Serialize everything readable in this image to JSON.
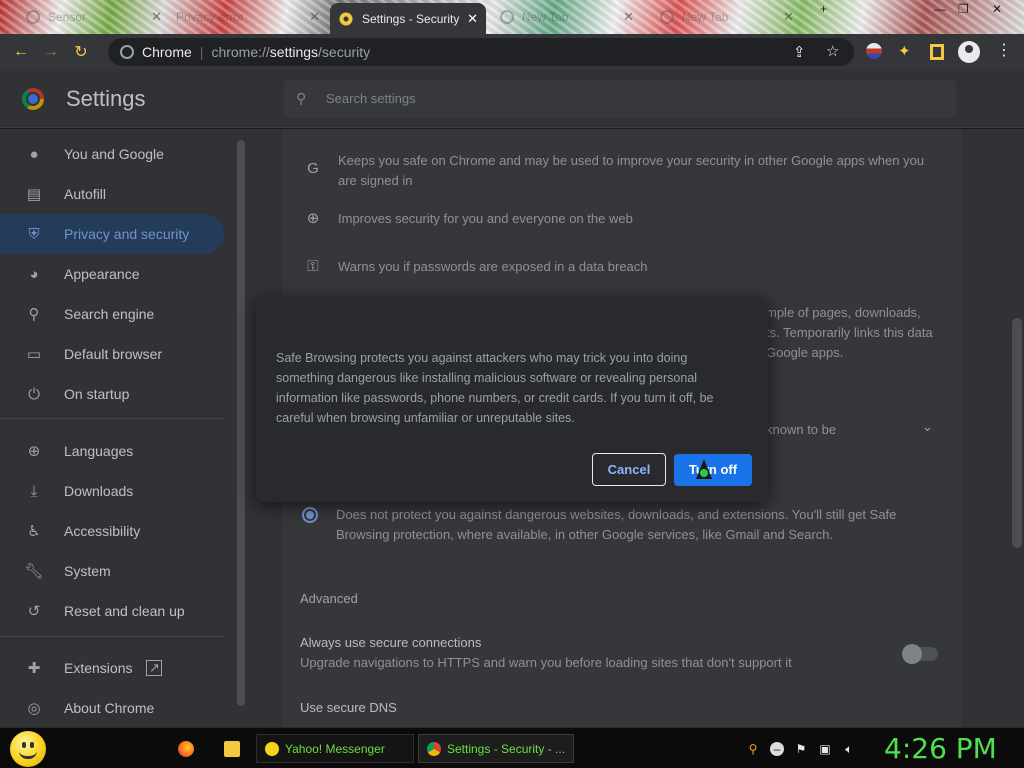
{
  "browser": {
    "tabs": [
      {
        "label": "Sensor",
        "active": false
      },
      {
        "label": "Privacy error",
        "active": false
      },
      {
        "label": "Settings - Security",
        "active": true
      },
      {
        "label": "New Tab",
        "active": false
      },
      {
        "label": "New Tab",
        "active": false
      }
    ],
    "omnibox": {
      "site": "Chrome",
      "url_prefix": "chrome://",
      "url_main": "settings",
      "url_suffix": "/security"
    }
  },
  "settings": {
    "title": "Settings",
    "search_placeholder": "Search settings",
    "sidebar": [
      {
        "label": "You and Google",
        "icon": "person-icon"
      },
      {
        "label": "Autofill",
        "icon": "clipboard-icon"
      },
      {
        "label": "Privacy and security",
        "icon": "shield-icon",
        "selected": true
      },
      {
        "label": "Appearance",
        "icon": "palette-icon"
      },
      {
        "label": "Search engine",
        "icon": "search-icon"
      },
      {
        "label": "Default browser",
        "icon": "browser-icon"
      },
      {
        "label": "On startup",
        "icon": "power-icon"
      },
      {
        "label": "Languages",
        "icon": "globe-icon"
      },
      {
        "label": "Downloads",
        "icon": "download-icon"
      },
      {
        "label": "Accessibility",
        "icon": "accessibility-icon"
      },
      {
        "label": "System",
        "icon": "wrench-icon"
      },
      {
        "label": "Reset and clean up",
        "icon": "restore-icon"
      },
      {
        "label": "Extensions",
        "icon": "puzzle-icon"
      },
      {
        "label": "About Chrome",
        "icon": "chrome-icon"
      }
    ],
    "content": {
      "item_google": "Keeps you safe on Chrome and may be used to improve your security in other Google apps when you are signed in",
      "item_web": "Improves security for you and everyone on the web",
      "item_passwords": "Warns you if passwords are exposed in a data breach",
      "partial_line1": "mple of pages, downloads,",
      "partial_line2": "ts. Temporarily links this data",
      "partial_line3": "Google apps.",
      "partial_dropdown": "known to be",
      "no_protection": "Does not protect you against dangerous websites, downloads, and extensions. You'll still get Safe Browsing protection, where available, in other Google services, like Gmail and Search.",
      "advanced_label": "Advanced",
      "secure_conn_title": "Always use secure connections",
      "secure_conn_desc": "Upgrade navigations to HTTPS and warn you before loading sites that don't support it",
      "secure_dns_title": "Use secure DNS"
    },
    "dialog": {
      "body": "Safe Browsing protects you against attackers who may trick you into doing something dangerous like installing malicious software or revealing personal information like passwords, phone numbers, or credit cards. If you turn it off, be careful when browsing unfamiliar or unreputable sites.",
      "cancel_label": "Cancel",
      "turn_off_label": "Turn off"
    }
  },
  "taskbar": {
    "yahoo_label": "Yahoo! Messenger",
    "chrome_label": "Settings - Security - ...",
    "clock": "4:26 PM"
  }
}
